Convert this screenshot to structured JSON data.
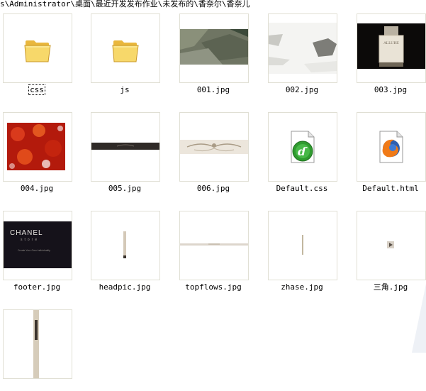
{
  "path": "s\\Administrator\\桌面\\最近开发发布作业\\未发布的\\香奈尔\\香奈儿",
  "files": [
    {
      "name": "css",
      "type": "folder-icon"
    },
    {
      "name": "js",
      "type": "folder-icon"
    },
    {
      "name": "001.jpg",
      "type": "image"
    },
    {
      "name": "002.jpg",
      "type": "image"
    },
    {
      "name": "003.jpg",
      "type": "image"
    },
    {
      "name": "004.jpg",
      "type": "image"
    },
    {
      "name": "005.jpg",
      "type": "image"
    },
    {
      "name": "006.jpg",
      "type": "image"
    },
    {
      "name": "Default.css",
      "type": "dreamweaver-css-icon"
    },
    {
      "name": "Default.html",
      "type": "firefox-html-icon"
    },
    {
      "name": "footer.jpg",
      "type": "image"
    },
    {
      "name": "headpic.jpg",
      "type": "image"
    },
    {
      "name": "topflows.jpg",
      "type": "image"
    },
    {
      "name": "zhase.jpg",
      "type": "image"
    },
    {
      "name": "三角.jpg",
      "type": "image"
    },
    {
      "name": "",
      "type": "image"
    }
  ],
  "footer_thumb": {
    "brand": "CHANEL",
    "sub": "store",
    "tagline": "Create Your Own Individuality"
  },
  "allure_label": "ALLURE",
  "colors": {
    "thumb_border": "#e0dfd4",
    "folder": "#f7d86a"
  }
}
